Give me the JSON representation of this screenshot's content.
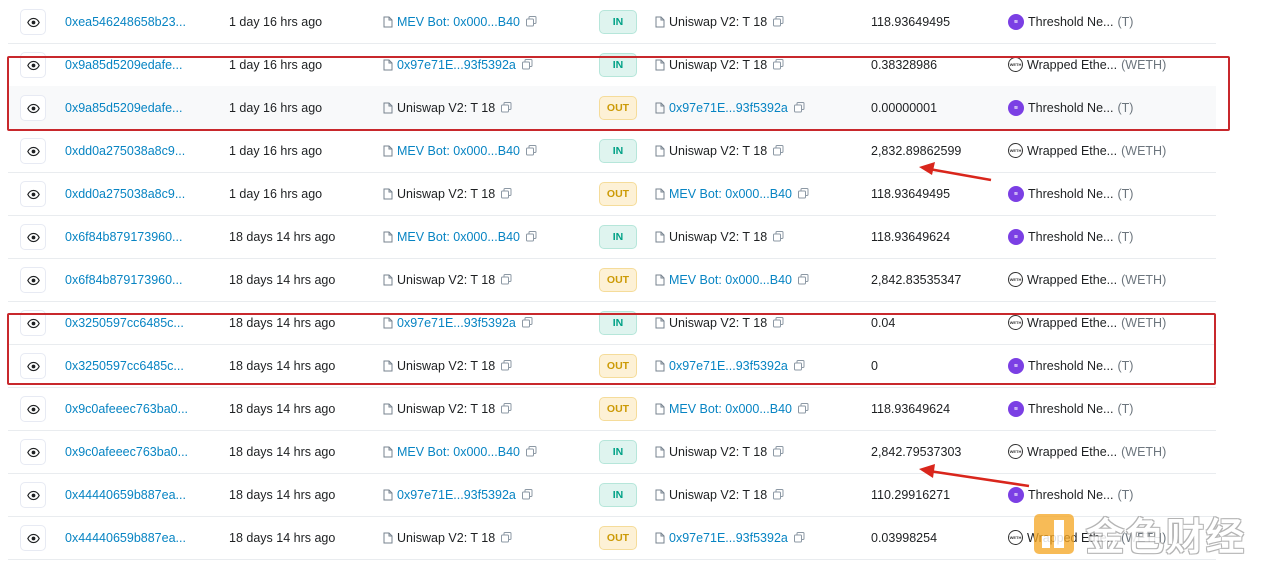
{
  "colors": {
    "link": "#0784c3",
    "in_badge_bg": "#dff4ef",
    "in_badge_text": "#00a186",
    "out_badge_bg": "#fdf1d6",
    "out_badge_text": "#cc9a06",
    "highlight_box": "#c8282c",
    "threshold_logo": "#7b3fe4"
  },
  "rows": [
    {
      "hash": "0xea546248658b23...",
      "age": "1 day 16 hrs ago",
      "from": "MEV Bot: 0x000...B40",
      "from_link": true,
      "dir": "IN",
      "to": "Uniswap V2: T 18",
      "to_link": false,
      "amount": "118.93649495",
      "token_name": "Threshold Ne...",
      "token_sym": "(T)",
      "token_logo": "t"
    },
    {
      "hash": "0x9a85d5209edafe...",
      "age": "1 day 16 hrs ago",
      "from": "0x97e71E...93f5392a",
      "from_link": true,
      "dir": "IN",
      "to": "Uniswap V2: T 18",
      "to_link": false,
      "amount": "0.38328986",
      "token_name": "Wrapped Ethe...",
      "token_sym": "(WETH)",
      "token_logo": "weth"
    },
    {
      "hash": "0x9a85d5209edafe...",
      "age": "1 day 16 hrs ago",
      "from": "Uniswap V2: T 18",
      "from_link": false,
      "dir": "OUT",
      "to": "0x97e71E...93f5392a",
      "to_link": true,
      "amount": "0.00000001",
      "token_name": "Threshold Ne...",
      "token_sym": "(T)",
      "token_logo": "t"
    },
    {
      "hash": "0xdd0a275038a8c9...",
      "age": "1 day 16 hrs ago",
      "from": "MEV Bot: 0x000...B40",
      "from_link": true,
      "dir": "IN",
      "to": "Uniswap V2: T 18",
      "to_link": false,
      "amount": "2,832.89862599",
      "token_name": "Wrapped Ethe...",
      "token_sym": "(WETH)",
      "token_logo": "weth"
    },
    {
      "hash": "0xdd0a275038a8c9...",
      "age": "1 day 16 hrs ago",
      "from": "Uniswap V2: T 18",
      "from_link": false,
      "dir": "OUT",
      "to": "MEV Bot: 0x000...B40",
      "to_link": true,
      "amount": "118.93649495",
      "token_name": "Threshold Ne...",
      "token_sym": "(T)",
      "token_logo": "t"
    },
    {
      "hash": "0x6f84b879173960...",
      "age": "18 days 14 hrs ago",
      "from": "MEV Bot: 0x000...B40",
      "from_link": true,
      "dir": "IN",
      "to": "Uniswap V2: T 18",
      "to_link": false,
      "amount": "118.93649624",
      "token_name": "Threshold Ne...",
      "token_sym": "(T)",
      "token_logo": "t"
    },
    {
      "hash": "0x6f84b879173960...",
      "age": "18 days 14 hrs ago",
      "from": "Uniswap V2: T 18",
      "from_link": false,
      "dir": "OUT",
      "to": "MEV Bot: 0x000...B40",
      "to_link": true,
      "amount": "2,842.83535347",
      "token_name": "Wrapped Ethe...",
      "token_sym": "(WETH)",
      "token_logo": "weth"
    },
    {
      "hash": "0x3250597cc6485c...",
      "age": "18 days 14 hrs ago",
      "from": "0x97e71E...93f5392a",
      "from_link": true,
      "dir": "IN",
      "to": "Uniswap V2: T 18",
      "to_link": false,
      "amount": "0.04",
      "token_name": "Wrapped Ethe...",
      "token_sym": "(WETH)",
      "token_logo": "weth"
    },
    {
      "hash": "0x3250597cc6485c...",
      "age": "18 days 14 hrs ago",
      "from": "Uniswap V2: T 18",
      "from_link": false,
      "dir": "OUT",
      "to": "0x97e71E...93f5392a",
      "to_link": true,
      "amount": "0",
      "token_name": "Threshold Ne...",
      "token_sym": "(T)",
      "token_logo": "t"
    },
    {
      "hash": "0x9c0afeeec763ba0...",
      "age": "18 days 14 hrs ago",
      "from": "Uniswap V2: T 18",
      "from_link": false,
      "dir": "OUT",
      "to": "MEV Bot: 0x000...B40",
      "to_link": true,
      "amount": "118.93649624",
      "token_name": "Threshold Ne...",
      "token_sym": "(T)",
      "token_logo": "t"
    },
    {
      "hash": "0x9c0afeeec763ba0...",
      "age": "18 days 14 hrs ago",
      "from": "MEV Bot: 0x000...B40",
      "from_link": true,
      "dir": "IN",
      "to": "Uniswap V2: T 18",
      "to_link": false,
      "amount": "2,842.79537303",
      "token_name": "Wrapped Ethe...",
      "token_sym": "(WETH)",
      "token_logo": "weth"
    },
    {
      "hash": "0x44440659b887ea...",
      "age": "18 days 14 hrs ago",
      "from": "0x97e71E...93f5392a",
      "from_link": true,
      "dir": "IN",
      "to": "Uniswap V2: T 18",
      "to_link": false,
      "amount": "110.29916271",
      "token_name": "Threshold Ne...",
      "token_sym": "(T)",
      "token_logo": "t"
    },
    {
      "hash": "0x44440659b887ea...",
      "age": "18 days 14 hrs ago",
      "from": "Uniswap V2: T 18",
      "from_link": false,
      "dir": "OUT",
      "to": "0x97e71E...93f5392a",
      "to_link": true,
      "amount": "0.03998254",
      "token_name": "Wrapped Ethe...",
      "token_sym": "(WETH)",
      "token_logo": "weth"
    }
  ],
  "watermark": {
    "text": "金色财经"
  }
}
